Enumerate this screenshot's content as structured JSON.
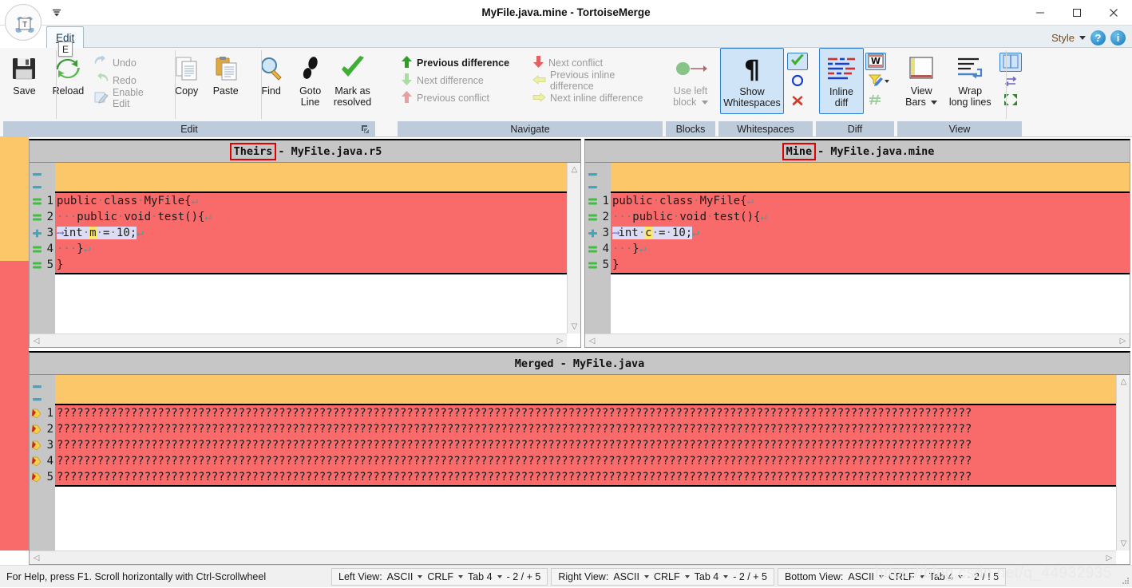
{
  "window": {
    "title": "MyFile.java.mine - TortoiseMerge",
    "minimize_label": "—",
    "maximize_label": "☐",
    "close_label": "✕",
    "app_button_label": "T",
    "qat_more_label": "☰"
  },
  "tabs": {
    "edit": {
      "label": "Edit",
      "keytip": "E"
    }
  },
  "style_bar": {
    "label": "Style",
    "help_label": "?",
    "info_label": "i"
  },
  "ribbon": {
    "groups": [
      {
        "name": "Edit",
        "title": "Edit",
        "big_buttons": [
          {
            "label": "Save",
            "icon": "floppy-disk-icon",
            "enabled": true
          },
          {
            "label": "Reload",
            "icon": "refresh-arrows-icon",
            "enabled": true
          },
          {
            "label": "Copy",
            "icon": "copy-pages-icon",
            "enabled": true
          },
          {
            "label": "Paste",
            "icon": "clipboard-icon",
            "enabled": true
          },
          {
            "label": "Find",
            "icon": "magnifier-icon",
            "enabled": true
          },
          {
            "label": "Goto Line",
            "line1": "Goto",
            "line2": "Line",
            "icon": "footsteps-icon",
            "enabled": true
          },
          {
            "label": "Mark as resolved",
            "line1": "Mark as",
            "line2": "resolved",
            "icon": "green-check-icon",
            "enabled": true
          }
        ],
        "small_buttons": [
          {
            "label": "Undo",
            "icon": "undo-arrow-icon",
            "enabled": false
          },
          {
            "label": "Redo",
            "icon": "redo-arrow-icon",
            "enabled": false
          },
          {
            "label": "Enable Edit",
            "icon": "pencil-edit-icon",
            "enabled": false
          }
        ]
      },
      {
        "name": "Navigate",
        "title": "Navigate",
        "items": [
          {
            "label": "Previous difference",
            "icon": "arrow-up-green-icon",
            "enabled": true
          },
          {
            "label": "Next difference",
            "icon": "arrow-down-green-icon",
            "enabled": false
          },
          {
            "label": "Previous conflict",
            "icon": "arrow-up-red-icon",
            "enabled": false
          },
          {
            "label": "Next conflict",
            "icon": "arrow-down-red-icon",
            "enabled": false
          },
          {
            "label": "Previous inline difference",
            "icon": "arrow-left-yellow-icon",
            "enabled": false
          },
          {
            "label": "Next inline difference",
            "icon": "arrow-right-yellow-icon",
            "enabled": false
          }
        ]
      },
      {
        "name": "Blocks",
        "title": "Blocks",
        "big_buttons": [
          {
            "line1": "Use left",
            "line2": "block",
            "label": "Use left block",
            "icon": "use-left-block-icon",
            "enabled": false,
            "has_dropdown": true
          }
        ]
      },
      {
        "name": "Whitespaces",
        "title": "Whitespaces",
        "big_buttons": [
          {
            "line1": "Show",
            "line2": "Whitespaces",
            "label": "Show Whitespaces",
            "icon": "pilcrow-icon",
            "enabled": true,
            "selected": true
          }
        ],
        "small_buttons": [
          {
            "label": "",
            "icon": "green-check-icon",
            "enabled": true,
            "selected": true
          },
          {
            "label": "",
            "icon": "blue-circle-icon",
            "enabled": true
          },
          {
            "label": "",
            "icon": "red-x-icon",
            "enabled": true
          }
        ]
      },
      {
        "name": "Diff",
        "title": "Diff",
        "big_buttons": [
          {
            "line1": "Inline",
            "line2": "diff",
            "label": "Inline diff",
            "icon": "inline-diff-lines-icon",
            "enabled": true,
            "selected": true
          }
        ],
        "small_buttons": [
          {
            "label": "",
            "icon": "word-diff-icon",
            "enabled": true,
            "selected": true
          },
          {
            "label": "",
            "icon": "filter-pencil-icon",
            "enabled": true,
            "has_dropdown": true
          },
          {
            "label": "",
            "icon": "hash-green-icon",
            "enabled": false
          }
        ]
      },
      {
        "name": "View",
        "title": "View",
        "big_buttons": [
          {
            "line1": "View",
            "line2": "Bars",
            "label": "View Bars",
            "icon": "view-bars-icon",
            "enabled": true,
            "has_dropdown": true
          },
          {
            "line1": "Wrap",
            "line2": "long lines",
            "label": "Wrap long lines",
            "icon": "wrap-lines-icon",
            "enabled": true
          }
        ],
        "small_buttons": [
          {
            "label": "",
            "icon": "two-pane-view-icon",
            "enabled": true,
            "selected": true
          },
          {
            "label": "",
            "icon": "swap-arrows-icon",
            "enabled": true
          },
          {
            "label": "",
            "icon": "collapse-arrows-icon",
            "enabled": true
          }
        ]
      }
    ]
  },
  "panes": {
    "left": {
      "badge": "Theirs",
      "title_rest": " - MyFile.java.r5",
      "lines": [
        {
          "num": "1",
          "marker": "equal",
          "segments": [
            {
              "t": "public",
              "k": "code"
            },
            {
              "t": "·",
              "k": "ws"
            },
            {
              "t": "class",
              "k": "code"
            },
            {
              "t": "·",
              "k": "ws"
            },
            {
              "t": "MyFile{",
              "k": "code"
            },
            {
              "t": "↵",
              "k": "crlf"
            }
          ]
        },
        {
          "num": "2",
          "marker": "equal",
          "segments": [
            {
              "t": "···",
              "k": "ws"
            },
            {
              "t": "public",
              "k": "code"
            },
            {
              "t": "·",
              "k": "ws"
            },
            {
              "t": "void",
              "k": "code"
            },
            {
              "t": "·",
              "k": "ws"
            },
            {
              "t": "test(){",
              "k": "code"
            },
            {
              "t": "↵",
              "k": "crlf"
            }
          ]
        },
        {
          "num": "3",
          "marker": "added",
          "modified": true,
          "segments": [
            {
              "t": "⟶",
              "k": "tab"
            },
            {
              "t": "int",
              "k": "code"
            },
            {
              "t": "·",
              "k": "ws"
            },
            {
              "t": "m",
              "k": "hl"
            },
            {
              "t": "·",
              "k": "ws"
            },
            {
              "t": "=",
              "k": "code"
            },
            {
              "t": "·",
              "k": "ws"
            },
            {
              "t": "10;",
              "k": "code"
            },
            {
              "t": "↵",
              "k": "crlf"
            }
          ]
        },
        {
          "num": "4",
          "marker": "equal",
          "segments": [
            {
              "t": "···",
              "k": "ws"
            },
            {
              "t": "}",
              "k": "code"
            },
            {
              "t": "↵",
              "k": "crlf"
            }
          ]
        },
        {
          "num": "5",
          "marker": "equal",
          "segments": [
            {
              "t": "}",
              "k": "code"
            }
          ]
        }
      ]
    },
    "right": {
      "badge": "Mine",
      "title_rest": " - MyFile.java.mine",
      "lines": [
        {
          "num": "1",
          "marker": "equal",
          "segments": [
            {
              "t": "public",
              "k": "code"
            },
            {
              "t": "·",
              "k": "ws"
            },
            {
              "t": "class",
              "k": "code"
            },
            {
              "t": "·",
              "k": "ws"
            },
            {
              "t": "MyFile{",
              "k": "code"
            },
            {
              "t": "↵",
              "k": "crlf"
            }
          ]
        },
        {
          "num": "2",
          "marker": "equal",
          "segments": [
            {
              "t": "···",
              "k": "ws"
            },
            {
              "t": "public",
              "k": "code"
            },
            {
              "t": "·",
              "k": "ws"
            },
            {
              "t": "void",
              "k": "code"
            },
            {
              "t": "·",
              "k": "ws"
            },
            {
              "t": "test(){",
              "k": "code"
            },
            {
              "t": "↵",
              "k": "crlf"
            }
          ]
        },
        {
          "num": "3",
          "marker": "added",
          "modified": true,
          "segments": [
            {
              "t": "⟶",
              "k": "tab"
            },
            {
              "t": "int",
              "k": "code"
            },
            {
              "t": "·",
              "k": "ws"
            },
            {
              "t": "c",
              "k": "hl"
            },
            {
              "t": "·",
              "k": "ws"
            },
            {
              "t": "=",
              "k": "code"
            },
            {
              "t": "·",
              "k": "ws"
            },
            {
              "t": "10;",
              "k": "code"
            },
            {
              "t": "↵",
              "k": "crlf"
            }
          ]
        },
        {
          "num": "4",
          "marker": "equal",
          "segments": [
            {
              "t": "···",
              "k": "ws"
            },
            {
              "t": "}",
              "k": "code"
            },
            {
              "t": "↵",
              "k": "crlf"
            }
          ]
        },
        {
          "num": "5",
          "marker": "equal",
          "segments": [
            {
              "t": "}",
              "k": "code"
            }
          ]
        }
      ]
    },
    "merged": {
      "title": "Merged - MyFile.java",
      "lines": [
        {
          "num": "1",
          "marker": "conflict",
          "text": "????????????????????????????????????????????????????????????????????????????????????????????????????????????????????????????????????????"
        },
        {
          "num": "2",
          "marker": "conflict",
          "text": "????????????????????????????????????????????????????????????????????????????????????????????????????????????????????????????????????????"
        },
        {
          "num": "3",
          "marker": "conflict",
          "text": "????????????????????????????????????????????????????????????????????????????????????????????????????????????????????????????????????????"
        },
        {
          "num": "4",
          "marker": "conflict",
          "text": "????????????????????????????????????????????????????????????????????????????????????????????????????????????????????????????????????????"
        },
        {
          "num": "5",
          "marker": "conflict",
          "text": "????????????????????????????????????????????????????????????????????????????????????????????????????????????????????????????????????????"
        }
      ]
    }
  },
  "statusbar": {
    "help_text": "For Help, press F1. Scroll horizontally with Ctrl-Scrollwheel",
    "groups": [
      {
        "caption": "Left View:",
        "encoding": "ASCII",
        "eol": "CRLF",
        "tab": "Tab 4",
        "counts": "- 2 / + 5"
      },
      {
        "caption": "Right View:",
        "encoding": "ASCII",
        "eol": "CRLF",
        "tab": "Tab 4",
        "counts": "- 2 / + 5"
      },
      {
        "caption": "Bottom View:",
        "encoding": "ASCII",
        "eol": "CRLF",
        "tab": "Tab 4",
        "counts": "- 2 / ! 5"
      }
    ],
    "watermark": "https://blog.csdn.net/q_44932935"
  },
  "colors": {
    "diff_added": "#f96a6a",
    "diff_empty": "#fcc768",
    "inline_modified": "#dcdcf5",
    "inline_highlight": "#ffe96b",
    "ribbon_group_title": "#bdcbdb",
    "selection": "#cfe4f7",
    "badge_outline": "#e00000"
  }
}
